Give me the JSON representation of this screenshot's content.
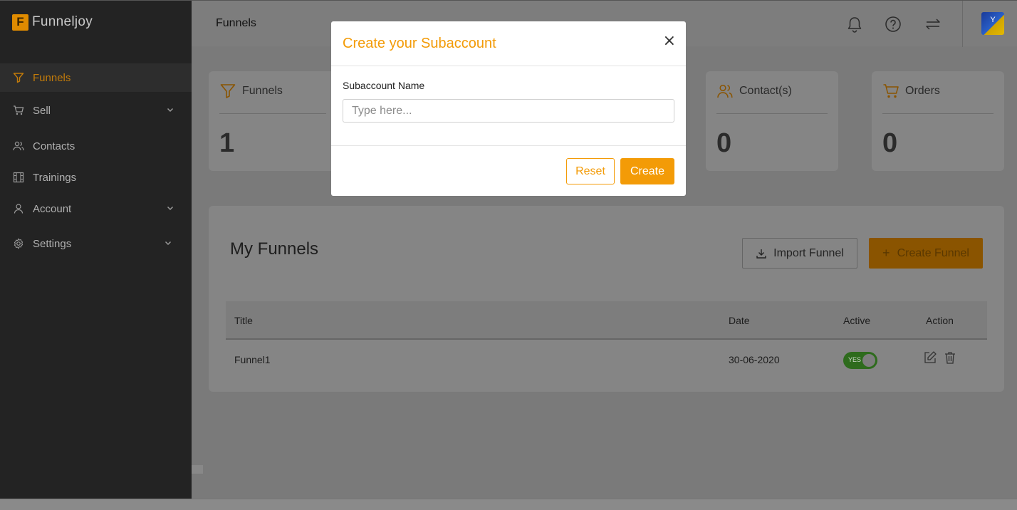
{
  "brand": {
    "logo_letter": "F",
    "name": "Funneljoy"
  },
  "sidebar": {
    "items": [
      {
        "label": "Funnels",
        "icon": "filter-icon",
        "active": true
      },
      {
        "label": "Sell",
        "icon": "cart-icon",
        "has_submenu": true
      },
      {
        "label": "Contacts",
        "icon": "users-icon"
      },
      {
        "label": "Trainings",
        "icon": "film-icon"
      },
      {
        "label": "Account",
        "icon": "user-icon",
        "has_submenu": true
      },
      {
        "label": "Settings",
        "icon": "gear-icon",
        "has_submenu": true
      }
    ]
  },
  "topbar": {
    "title": "Funnels",
    "icons": [
      "bell-icon",
      "help-icon",
      "switch-icon"
    ],
    "avatar_text": "Y"
  },
  "stats": [
    {
      "label": "Funnels",
      "value": "1",
      "icon": "filter-icon"
    },
    {
      "label": "Contact(s)",
      "value": "0",
      "icon": "users-icon"
    },
    {
      "label": "Orders",
      "value": "0",
      "icon": "cart-icon"
    }
  ],
  "funnels_panel": {
    "title": "My Funnels",
    "import_label": "Import Funnel",
    "create_label": "Create Funnel",
    "columns": [
      "Title",
      "Date",
      "Active",
      "Action"
    ],
    "rows": [
      {
        "title": "Funnel1",
        "date": "30-06-2020",
        "active": "YES"
      }
    ]
  },
  "modal": {
    "title": "Create your Subaccount",
    "close_label": "×",
    "field_label": "Subaccount Name",
    "field_placeholder": "Type here...",
    "field_value": "",
    "reset_label": "Reset",
    "create_label": "Create"
  },
  "colors": {
    "accent": "#f39b07",
    "sidebar_bg": "#232323",
    "overlay_bg": "#7a7a7a",
    "toggle_on": "#2e6b1d"
  }
}
